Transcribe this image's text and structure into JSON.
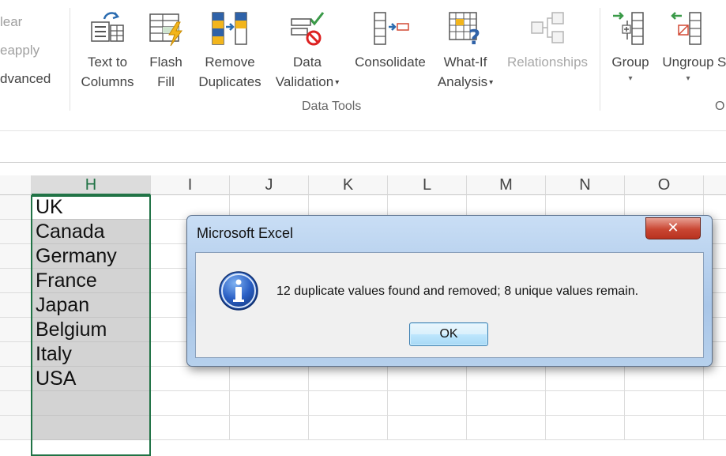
{
  "ribbon": {
    "sort_filter": {
      "clear": "lear",
      "reapply": "eapply",
      "advanced": "dvanced"
    },
    "buttons": [
      {
        "line1": "Text to",
        "line2": "Columns"
      },
      {
        "line1": "Flash",
        "line2": "Fill"
      },
      {
        "line1": "Remove",
        "line2": "Duplicates"
      },
      {
        "line1": "Data",
        "line2": "Validation"
      },
      {
        "line1": "Consolidate",
        "line2": ""
      },
      {
        "line1": "What-If",
        "line2": "Analysis"
      },
      {
        "line1": "Relationships",
        "line2": ""
      },
      {
        "line1": "Group",
        "line2": ""
      },
      {
        "line1": "Ungroup",
        "line2": ""
      },
      {
        "line1": "S",
        "line2": ""
      }
    ],
    "group_label": "Data Tools",
    "outline_label": "O"
  },
  "grid": {
    "columns": [
      "H",
      "I",
      "J",
      "K",
      "L",
      "M",
      "N",
      "O"
    ],
    "selected_column": "H",
    "values": [
      "UK",
      "Canada",
      "Germany",
      "France",
      "Japan",
      "Belgium",
      "Italy",
      "USA",
      "",
      ""
    ]
  },
  "dialog": {
    "title": "Microsoft Excel",
    "close_glyph": "✕",
    "message": "12 duplicate values found and removed; 8 unique values remain.",
    "ok_label": "OK"
  },
  "colors": {
    "excel_green": "#217346",
    "selection_gray": "#d3d3d3"
  }
}
